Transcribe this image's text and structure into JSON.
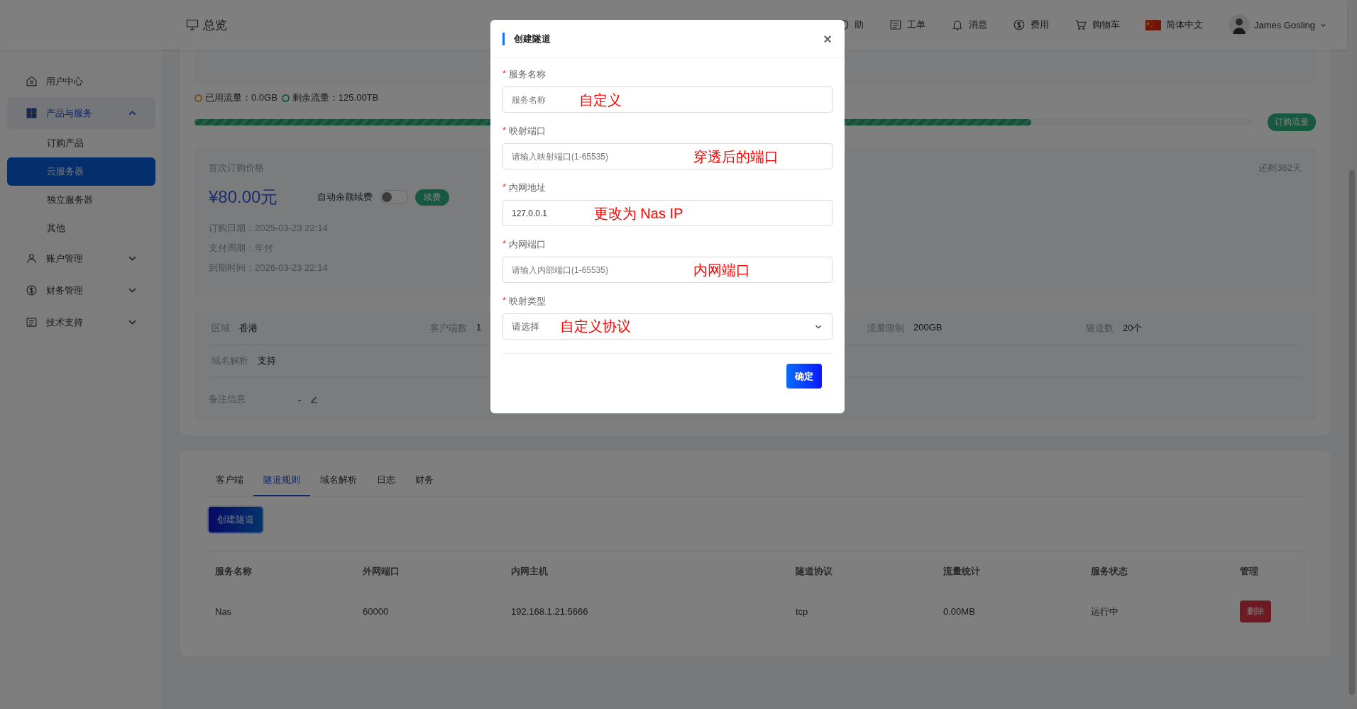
{
  "header": {
    "title": "总览",
    "nav": [
      {
        "label": "助"
      },
      {
        "label": "工单"
      },
      {
        "label": "消息"
      },
      {
        "label": "费用"
      },
      {
        "label": "购物车"
      },
      {
        "label": "简体中文"
      }
    ],
    "user": {
      "name": "James Gosling"
    }
  },
  "sidebar": {
    "items": [
      {
        "label": "用户中心",
        "selected": false
      },
      {
        "label": "产品与服务",
        "selected": true,
        "expanded": true,
        "children": [
          {
            "label": "订购产品",
            "selected": false
          },
          {
            "label": "云服务器",
            "selected": true
          },
          {
            "label": "独立服务器",
            "selected": false
          },
          {
            "label": "其他",
            "selected": false
          }
        ]
      },
      {
        "label": "账户管理",
        "selected": false,
        "expanded": false
      },
      {
        "label": "财务管理",
        "selected": false,
        "expanded": false
      },
      {
        "label": "技术支持",
        "selected": false,
        "expanded": false
      }
    ]
  },
  "overview": {
    "traffic_legend": [
      {
        "kind": "used",
        "label": "已用流量：0.0GB"
      },
      {
        "kind": "remaining",
        "label": "剩余流量：125.00TB"
      }
    ],
    "traffic_bar": {
      "level": 0.79
    },
    "buy_traffic_button": "订购流量",
    "price": {
      "label": "首次订购价格",
      "amount": "¥80.00元",
      "days_left": "还剩362天",
      "auto_renew": {
        "label": "自动余额续费",
        "on": false
      },
      "renew_button": "续费",
      "details": [
        "订购日期：2025-03-23 22:14",
        "支付周期：年付",
        "到期时间：2026-03-23 22:14"
      ]
    },
    "spec_rows": [
      {
        "cells": [
          {
            "label": "区域",
            "value": "香港"
          },
          {
            "label": "客户端数",
            "value": "1"
          },
          {
            "label": "流量限制",
            "value": "200GB"
          },
          {
            "label": "隧道数",
            "value": "20个"
          }
        ]
      },
      {
        "cells": [
          {
            "label": "域名解析",
            "value": "支持"
          }
        ]
      }
    ],
    "note": {
      "label": "备注信息",
      "value": "-"
    }
  },
  "detail": {
    "tabs": [
      {
        "label": "客户端",
        "selected": false
      },
      {
        "label": "隧道规则",
        "selected": true
      },
      {
        "label": "域名解析",
        "selected": false
      },
      {
        "label": "日志",
        "selected": false
      },
      {
        "label": "财务",
        "selected": false
      }
    ],
    "create_button": "创建隧道",
    "table": {
      "columns": [
        "服务名称",
        "外网端口",
        "内网主机",
        "隧道协议",
        "流量统计",
        "服务状态",
        "管理"
      ],
      "rows": [
        {
          "cells": [
            "Nas",
            "60000",
            "192.168.1.21:5666",
            "tcp",
            "0.00MB",
            "运行中"
          ],
          "action": "删除"
        }
      ]
    }
  },
  "dialog": {
    "title": "创建隧道",
    "close": "×",
    "fields": [
      {
        "kind": "input",
        "required_mark": "*",
        "label": "服务名称",
        "placeholder": "服务名称",
        "annotation": "自定义"
      },
      {
        "kind": "input",
        "required_mark": "*",
        "label": "映射端口",
        "placeholder": "请输入映射端口(1-65535)",
        "annotation": "穿透后的端口"
      },
      {
        "kind": "input",
        "required_mark": "*",
        "label": "内网地址",
        "value": "127.0.0.1",
        "annotation": "更改为 Nas IP"
      },
      {
        "kind": "input",
        "required_mark": "*",
        "label": "内网端口",
        "placeholder": "请输入内部端口(1-65535)",
        "annotation": "内网端口"
      },
      {
        "kind": "select",
        "required_mark": "*",
        "label": "映射类型",
        "placeholder": "请选择",
        "annotation": "自定义协议"
      }
    ],
    "confirm_button": "确定"
  }
}
